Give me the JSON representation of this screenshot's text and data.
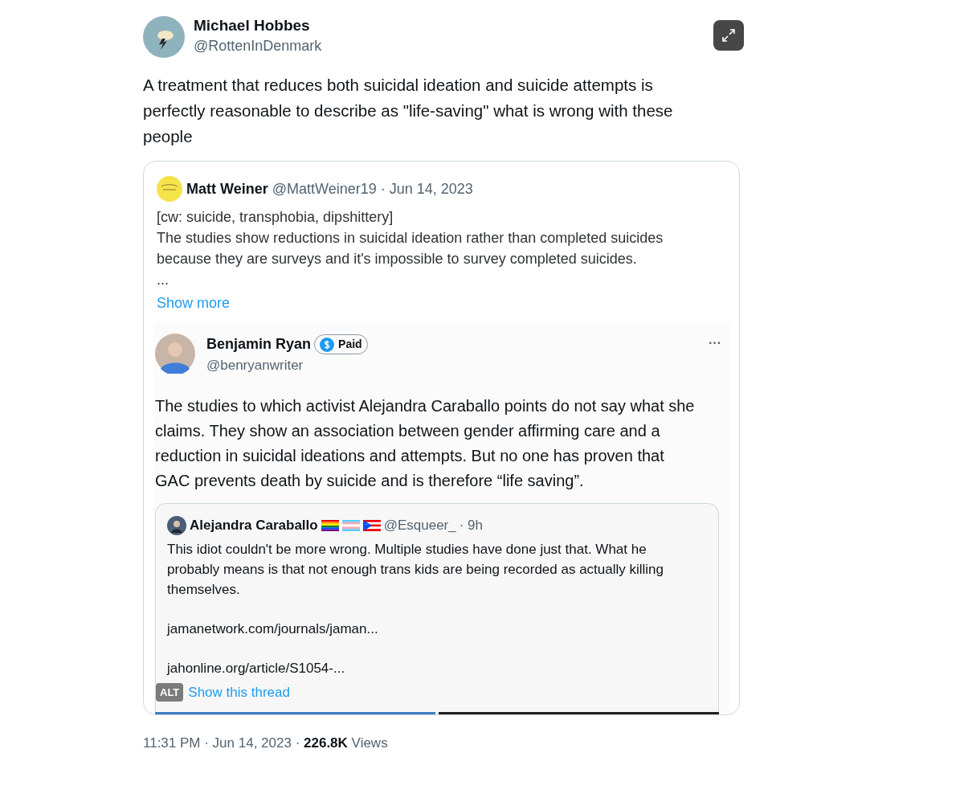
{
  "tweet": {
    "author": {
      "name": "Michael Hobbes",
      "handle": "@RottenInDenmark"
    },
    "text": "A treatment that reduces both suicidal ideation and suicide attempts is perfectly reasonable to describe as \"life-saving\" what is wrong with these people",
    "quote": {
      "author": {
        "name": "Matt Weiner",
        "handle": "@MattWeiner19",
        "date": "· Jun 14, 2023"
      },
      "lines": [
        "[cw: suicide, transphobia, dipshittery]",
        "The studies show reductions in suicidal ideation rather than completed suicides because they are surveys and it's impossible to survey completed suicides.",
        "..."
      ],
      "show_more": "Show more",
      "image": {
        "author": {
          "name": "Benjamin Ryan",
          "badge": "Paid",
          "handle": "@benryanwriter",
          "menu": "···"
        },
        "text": "The studies to which activist Alejandra Caraballo points do not say what she claims. They show an association between gender affirming care and a reduction in suicidal ideations and attempts. But no one has proven that GAC prevents death by suicide and is therefore “life saving”.",
        "inner_quote": {
          "name": "Alejandra Caraballo",
          "handle": "@Esqueer_",
          "time": "· 9h",
          "paragraphs": [
            "This idiot couldn't be more wrong. Multiple studies have done just that. What he probably means is that not enough trans kids are being recorded as actually killing themselves.",
            "jamanetwork.com/journals/jaman...",
            "jahonline.org/article/S1054-..."
          ],
          "link": "Show this thread"
        },
        "alt": "ALT"
      },
      "indicators": [
        {
          "selected": true
        },
        {
          "selected": false
        }
      ]
    },
    "time": "11:31 PM · Jun 14, 2023 · ",
    "views_count": "226.8K",
    "views_label": "Views"
  }
}
